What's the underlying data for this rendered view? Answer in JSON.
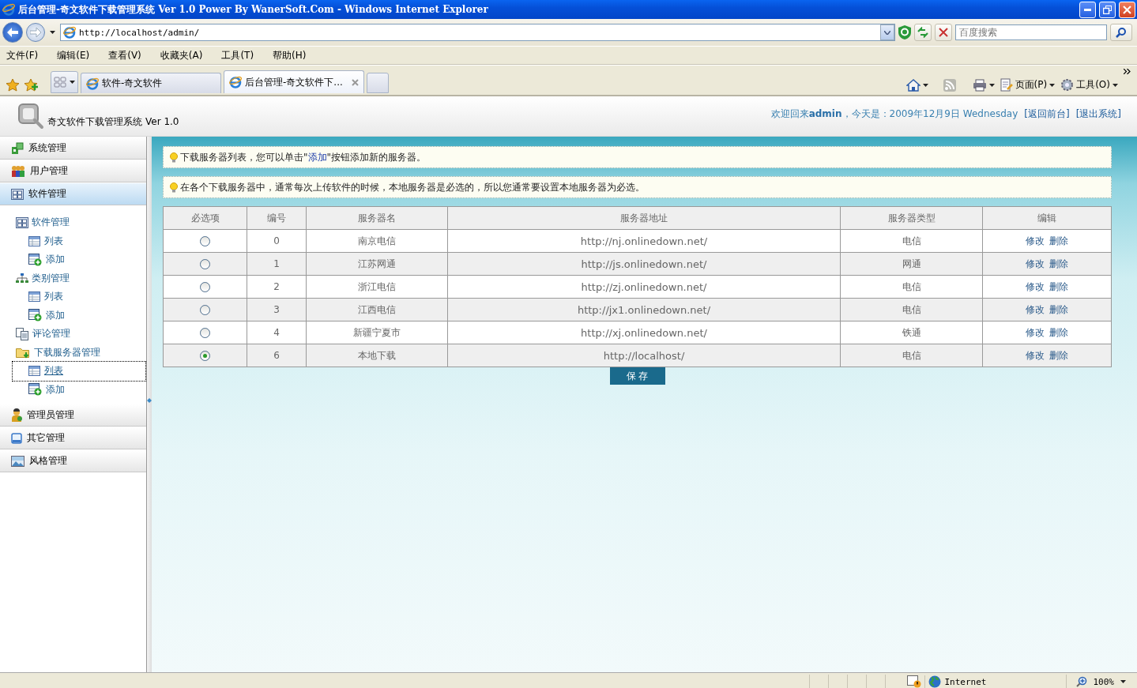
{
  "window": {
    "title": "后台管理-奇文软件下载管理系统 Ver 1.0 Power By WanerSoft.Com - Windows Internet Explorer"
  },
  "browser": {
    "address": "http://localhost/admin/",
    "search_placeholder": "百度搜索",
    "menu": [
      "文件(F)",
      "编辑(E)",
      "查看(V)",
      "收藏夹(A)",
      "工具(T)",
      "帮助(H)"
    ],
    "tabs": [
      {
        "label": "软件-奇文软件",
        "selected": false
      },
      {
        "label": "后台管理-奇文软件下...",
        "selected": true
      }
    ],
    "toolbar": [
      "页面(P)",
      "工具(O)"
    ]
  },
  "header": {
    "system_name": "奇文软件下载管理系统",
    "version": "Ver 1.0",
    "welcome": "欢迎回来**admin**，今天是：2009年12月9日 Wednesday",
    "links": [
      "[返回前台]",
      "[退出系统]"
    ]
  },
  "sidebar": {
    "sections": [
      {
        "label": "系统管理",
        "selected": false
      },
      {
        "label": "用户管理",
        "selected": false
      },
      {
        "label": "软件管理",
        "selected": true,
        "children": [
          {
            "label": "软件管理",
            "children": [
              {
                "label": "列表",
                "kind": "list",
                "selected": false
              },
              {
                "label": "添加",
                "kind": "add",
                "selected": false
              }
            ]
          },
          {
            "label": "类别管理",
            "children": [
              {
                "label": "列表",
                "kind": "list",
                "selected": false
              },
              {
                "label": "添加",
                "kind": "add",
                "selected": false
              }
            ]
          },
          {
            "label": "评论管理"
          },
          {
            "label": "下载服务器管理",
            "children": [
              {
                "label": "列表",
                "kind": "list",
                "selected": true
              },
              {
                "label": "添加",
                "kind": "add",
                "selected": false
              }
            ]
          }
        ]
      },
      {
        "label": "管理员管理",
        "selected": false
      },
      {
        "label": "其它管理",
        "selected": false
      },
      {
        "label": "风格管理",
        "selected": false
      }
    ]
  },
  "notices": [
    {
      "text_before": "下载服务器列表，您可以单击\"",
      "link": "添加",
      "text_after": "\"按钮添加新的服务器。"
    },
    {
      "text_before": "在各个下载服务器中，通常每次上传软件的时候，本地服务器是必选的，所以您通常要设置本地服务器为必选。"
    }
  ],
  "table": {
    "columns": [
      "必选项",
      "编号",
      "服务器名",
      "服务器地址",
      "服务器类型",
      "编辑"
    ],
    "rows": [
      {
        "selected": false,
        "id": "0",
        "name": "南京电信",
        "address": "http://nj.onlinedown.net/",
        "type": "电信",
        "actions": [
          "修改",
          "删除"
        ]
      },
      {
        "selected": false,
        "id": "1",
        "name": "江苏网通",
        "address": "http://js.onlinedown.net/",
        "type": "网通",
        "actions": [
          "修改",
          "删除"
        ]
      },
      {
        "selected": false,
        "id": "2",
        "name": "浙江电信",
        "address": "http://zj.onlinedown.net/",
        "type": "电信",
        "actions": [
          "修改",
          "删除"
        ]
      },
      {
        "selected": false,
        "id": "3",
        "name": "江西电信",
        "address": "http://jx1.onlinedown.net/",
        "type": "电信",
        "actions": [
          "修改",
          "删除"
        ]
      },
      {
        "selected": false,
        "id": "4",
        "name": "新疆宁夏市",
        "address": "http://xj.onlinedown.net/",
        "type": "铁通",
        "actions": [
          "修改",
          "删除"
        ]
      },
      {
        "selected": true,
        "id": "6",
        "name": "本地下载",
        "address": "http://localhost/",
        "type": "电信",
        "actions": [
          "修改",
          "删除"
        ]
      }
    ]
  },
  "save_button": "保 存",
  "status_bar": {
    "zone": "Internet",
    "zoom": "100%"
  }
}
